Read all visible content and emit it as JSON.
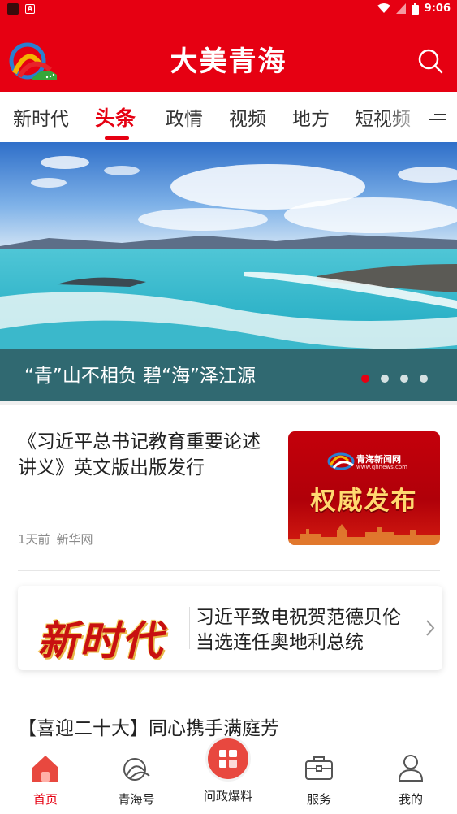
{
  "status_bar": {
    "time": "9:06"
  },
  "header": {
    "title": "大美青海"
  },
  "tabs": [
    {
      "label": "新时代"
    },
    {
      "label": "头条"
    },
    {
      "label": "政情"
    },
    {
      "label": "视频"
    },
    {
      "label": "地方"
    },
    {
      "label": "短视频"
    }
  ],
  "banner": {
    "caption": "“青”山不相负  碧“海”泽江源",
    "slide_count": 4,
    "active_index": 0
  },
  "news": [
    {
      "title": "《习近平总书记教育重要论述讲义》英文版出版发行",
      "time": "1天前",
      "source": "新华网",
      "thumb": {
        "brand": "青海新闻网",
        "url": "www.qhnews.com",
        "text": "权威发布"
      }
    },
    {
      "logo_text": "新时代",
      "title": "习近平致电祝贺范德贝伦当选连任奥地利总统"
    },
    {
      "title": "【喜迎二十大】同心携手满庭芳"
    }
  ],
  "bottom_nav": [
    {
      "label": "首页",
      "icon": "home-icon",
      "active": true
    },
    {
      "label": "青海号",
      "icon": "qinghai-account-icon"
    },
    {
      "label": "问政爆料",
      "icon": "report-icon"
    },
    {
      "label": "服务",
      "icon": "briefcase-icon"
    },
    {
      "label": "我的",
      "icon": "user-icon"
    }
  ],
  "colors": {
    "brand": "#e60012",
    "center_button": "#e8483f"
  }
}
